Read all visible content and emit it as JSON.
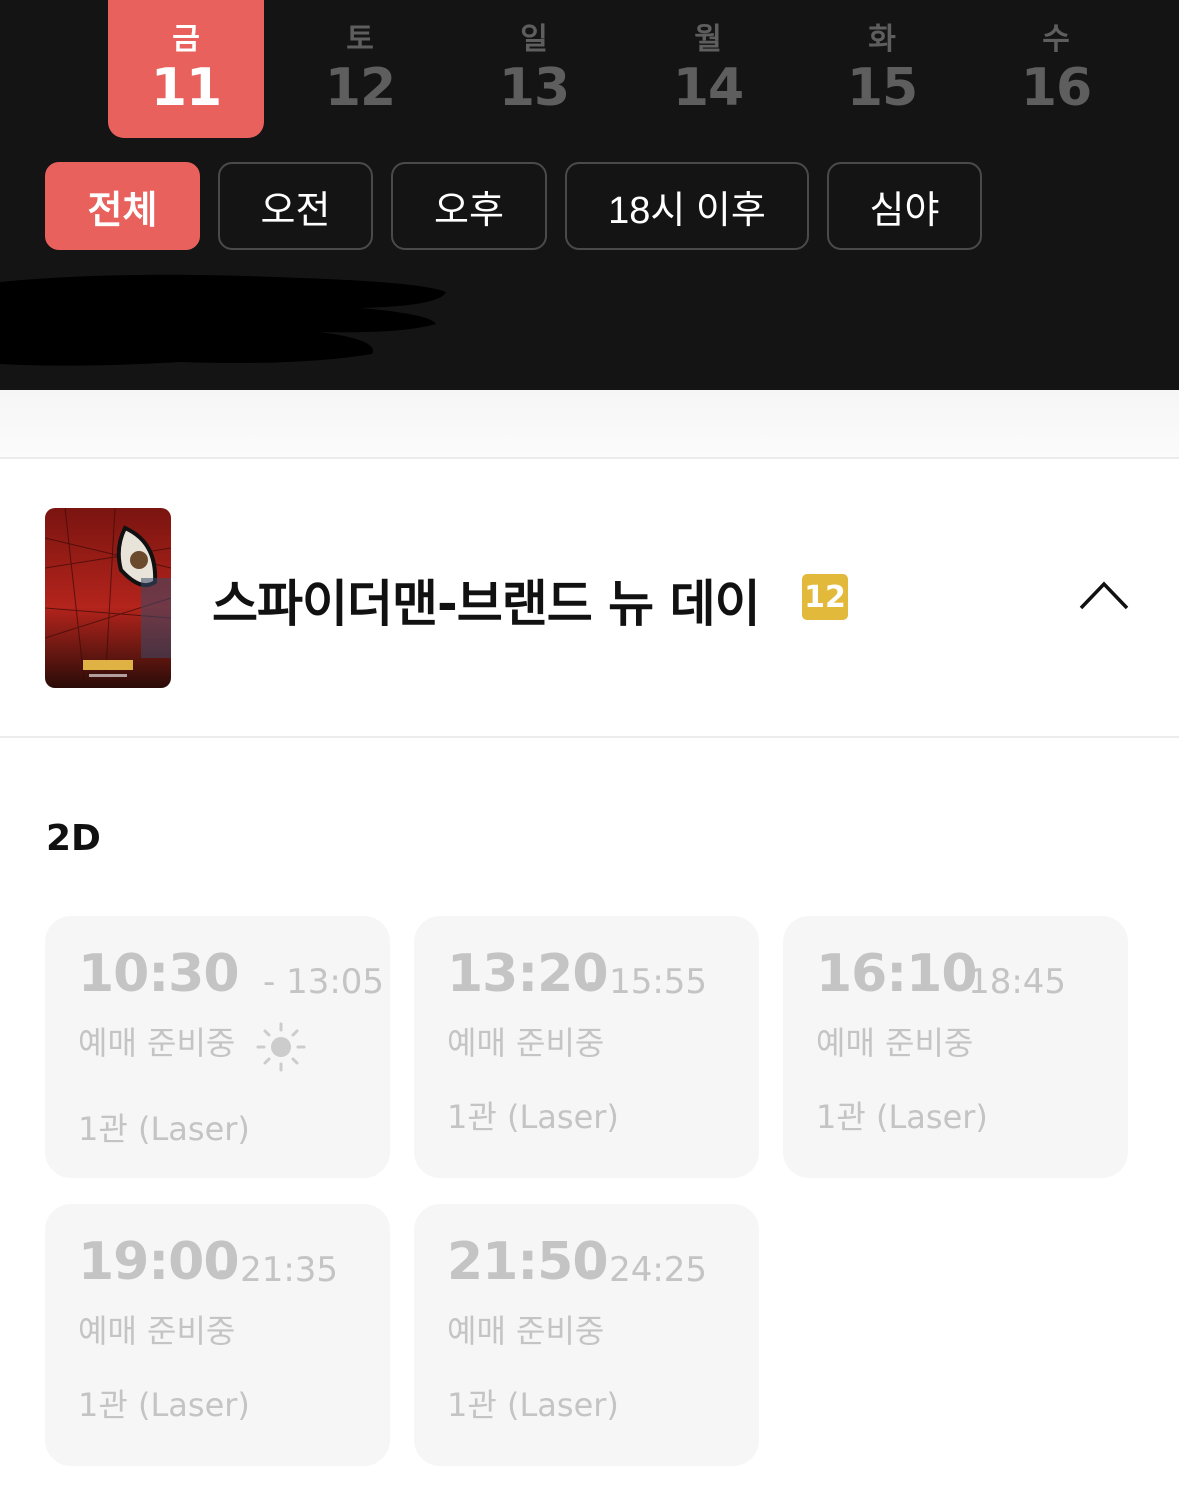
{
  "dates": [
    {
      "weekday": "금",
      "day": "11",
      "active": true
    },
    {
      "weekday": "토",
      "day": "12",
      "active": false
    },
    {
      "weekday": "일",
      "day": "13",
      "active": false
    },
    {
      "weekday": "월",
      "day": "14",
      "active": false
    },
    {
      "weekday": "화",
      "day": "15",
      "active": false
    },
    {
      "weekday": "수",
      "day": "16",
      "active": false
    }
  ],
  "filters": [
    "전체",
    "오전",
    "오후",
    "18시 이후",
    "심야"
  ],
  "movie": {
    "title": "스파이더맨-브랜드 뉴 데이",
    "rating": "12"
  },
  "format": "2D",
  "showtimes": [
    {
      "start": "10:30",
      "end": "- 13:05",
      "status": "예매 준비중",
      "screen": "1관 (Laser)",
      "morning": true
    },
    {
      "start": "13:20",
      "end": "- 15:55",
      "status": "예매 준비중",
      "screen": "1관 (Laser)",
      "morning": false
    },
    {
      "start": "16:10",
      "end": "- 18:45",
      "status": "예매 준비중",
      "screen": "1관 (Laser)",
      "morning": false
    },
    {
      "start": "19:00",
      "end": "- 21:35",
      "status": "예매 준비중",
      "screen": "1관 (Laser)",
      "morning": false
    },
    {
      "start": "21:50",
      "end": "- 24:25",
      "status": "예매 준비중",
      "screen": "1관 (Laser)",
      "morning": false
    }
  ],
  "colors": {
    "accent": "#e8615d",
    "dark_bg": "#141414",
    "rating": "#e3b93b",
    "card_bg": "#f6f6f6"
  },
  "icons": {
    "collapse": "chevron-up-icon",
    "morning": "sun-icon"
  }
}
